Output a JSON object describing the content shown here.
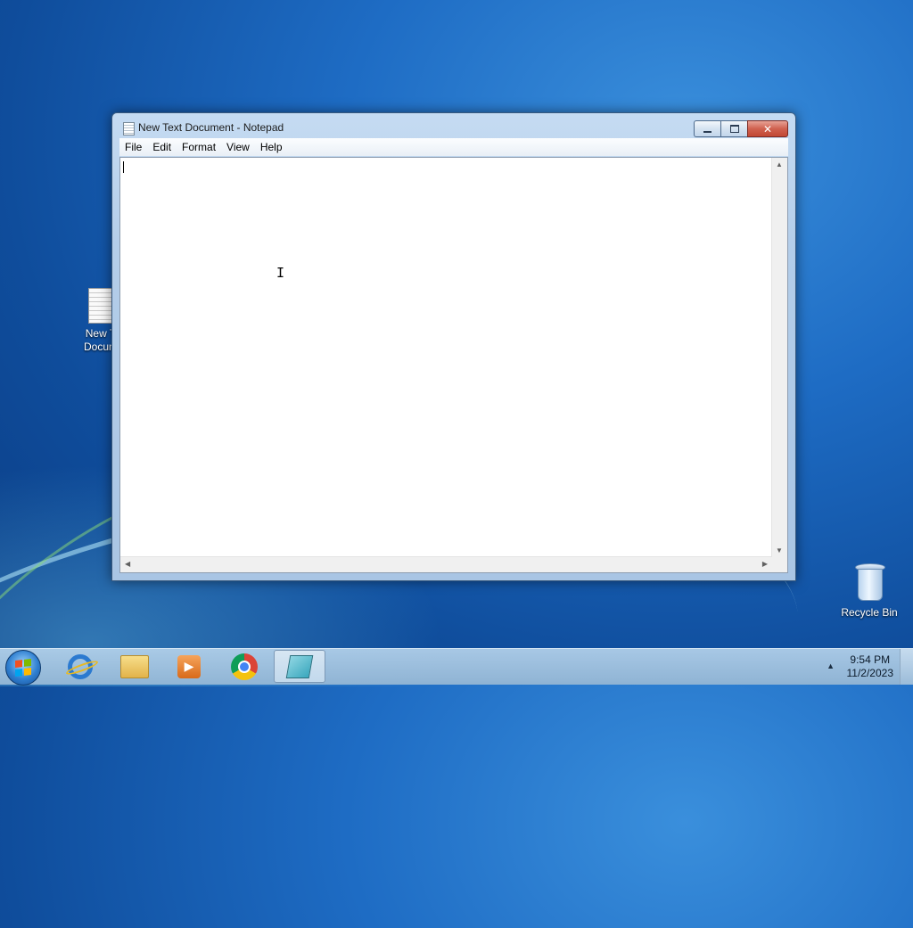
{
  "desktop": {
    "icons": [
      {
        "label_line1": "New T",
        "label_line2": "Docum",
        "icon": "text-document-icon"
      },
      {
        "label": "Recycle Bin",
        "icon": "recycle-bin-icon"
      }
    ]
  },
  "window": {
    "title": "New Text Document - Notepad",
    "menu": [
      "File",
      "Edit",
      "Format",
      "View",
      "Help"
    ],
    "content": "",
    "caption_buttons": [
      "minimize",
      "restore",
      "close"
    ]
  },
  "taskbar": {
    "pinned": [
      {
        "icon": "start-orb-icon"
      },
      {
        "icon": "internet-explorer-icon"
      },
      {
        "icon": "file-explorer-icon"
      },
      {
        "icon": "media-player-icon"
      },
      {
        "icon": "chrome-icon"
      },
      {
        "icon": "notepad-icon",
        "active": true
      }
    ],
    "clock": {
      "time": "9:54 PM",
      "date": "11/2/2023"
    }
  },
  "colors": {
    "desktop_blue": "#1e6cc4",
    "close_red": "#c24834"
  }
}
